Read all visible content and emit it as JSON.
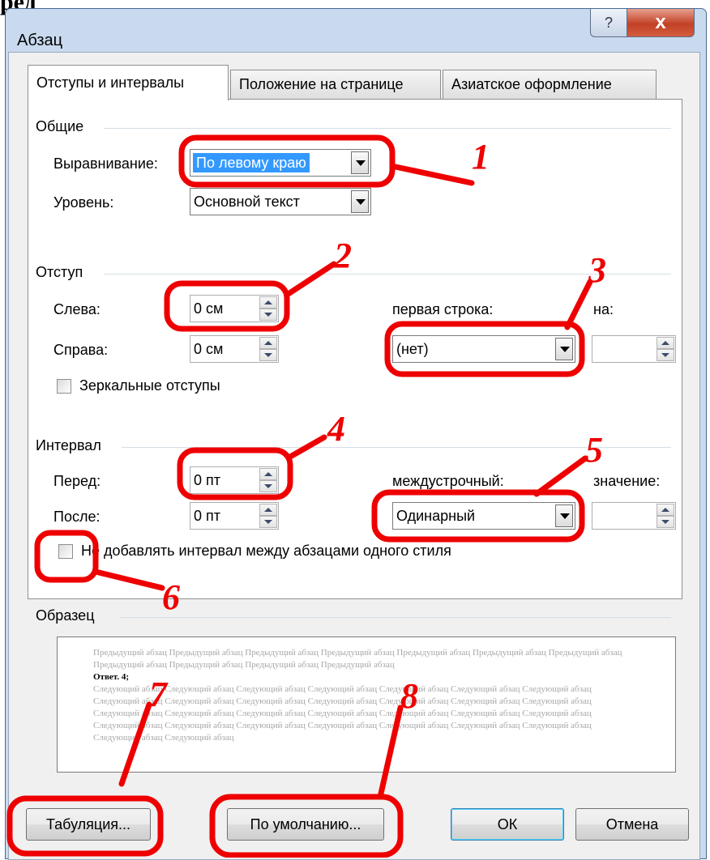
{
  "heading_fragment": "ред",
  "window": {
    "title": "Абзац",
    "help_glyph": "?",
    "close_glyph": "x"
  },
  "tabs": [
    {
      "label": "Отступы и интервалы",
      "active": true
    },
    {
      "label": "Положение на странице",
      "active": false
    },
    {
      "label": "Азиатское оформление",
      "active": false
    }
  ],
  "general": {
    "section": "Общие",
    "alignment_label": "Выравнивание:",
    "alignment_value": "По левому краю",
    "level_label": "Уровень:",
    "level_value": "Основной текст"
  },
  "indent": {
    "section": "Отступ",
    "left_label": "Слева:",
    "left_value": "0 см",
    "right_label": "Справа:",
    "right_value": "0 см",
    "first_line_label": "первая строка:",
    "first_line_value": "(нет)",
    "by_label": "на:",
    "by_value": "",
    "mirror_label": "Зеркальные отступы"
  },
  "spacing": {
    "section": "Интервал",
    "before_label": "Перед:",
    "before_value": "0 пт",
    "after_label": "После:",
    "after_value": "0 пт",
    "line_label": "междустрочный:",
    "line_value": "Одинарный",
    "at_label": "значение:",
    "at_value": "",
    "no_space_label": "Не добавлять интервал между абзацами одного стиля"
  },
  "preview": {
    "section": "Образец",
    "prev": "Предыдущий абзац Предыдущий абзац Предыдущий абзац Предыдущий абзац Предыдущий абзац Предыдущий абзац Предыдущий абзац Предыдущий абзац Предыдущий абзац Предыдущий абзац Предыдущий абзац",
    "current": "Ответ. 4;",
    "next": "Следующий абзац Следующий абзац Следующий абзац Следующий абзац Следующий абзац Следующий абзац Следующий абзац Следующий абзац Следующий абзац Следующий абзац Следующий абзац Следующий абзац Следующий абзац Следующий абзац Следующий абзац Следующий абзац Следующий абзац Следующий абзац Следующий абзац Следующий абзац Следующий абзац Следующий абзац Следующий абзац Следующий абзац Следующий абзац Следующий абзац Следующий абзац Следующий абзац Следующий абзац Следующий абзац"
  },
  "buttons": {
    "tabs": "Табуляция...",
    "default": "По умолчанию...",
    "ok": "ОК",
    "cancel": "Отмена"
  },
  "annotations": [
    "1",
    "2",
    "3",
    "4",
    "5",
    "6",
    "7",
    "8"
  ],
  "colors": {
    "annotation": "#ee0000",
    "selection": "#3399ff"
  }
}
